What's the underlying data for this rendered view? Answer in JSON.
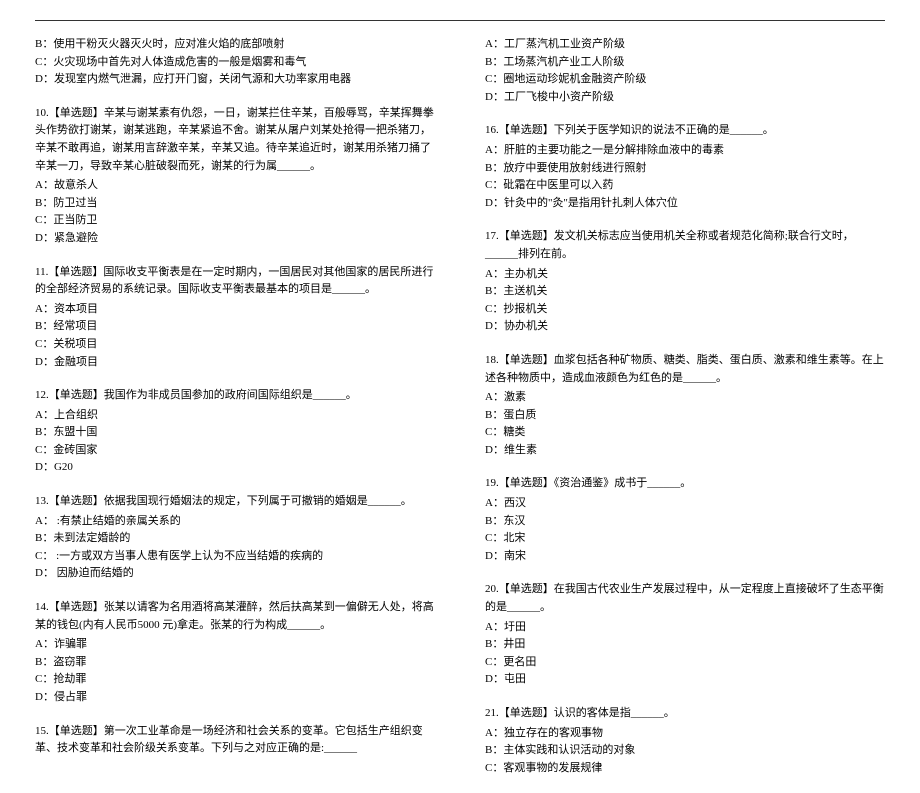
{
  "left": [
    {
      "stem": [],
      "options": [
        "B：使用干粉灭火器灭火时，应对准火焰的底部喷射",
        "C：火灾现场中首先对人体造成危害的一般是烟雾和毒气",
        "D：发现室内燃气泄漏，应打开门窗，关闭气源和大功率家用电器"
      ]
    },
    {
      "stem": [
        "10.【单选题】辛某与谢某素有仇怨，一日，谢某拦住辛某，百般辱骂，辛某挥舞拳头作势欲打谢某，谢某逃跑，辛某紧追不舍。谢某从屠户刘某处抢得一把杀猪刀，辛某不敢再追，谢某用言辞激辛某，辛某又追。待辛某追近时，谢某用杀猪刀捅了辛某一刀，导致辛某心脏破裂而死，谢某的行为属______。"
      ],
      "options": [
        "A：故意杀人",
        "B：防卫过当",
        "C：正当防卫",
        "D：紧急避险"
      ]
    },
    {
      "stem": [
        "11.【单选题】国际收支平衡表是在一定时期内，一国居民对其他国家的居民所进行的全部经济贸易的系统记录。国际收支平衡表最基本的项目是______。"
      ],
      "options": [
        "A：资本项目",
        "B：经常项目",
        "C：关税项目",
        "D：金融项目"
      ]
    },
    {
      "stem": [
        "12.【单选题】我国作为非成员国参加的政府间国际组织是______。"
      ],
      "options": [
        "A：上合组织",
        "B：东盟十国",
        "C：金砖国家",
        "D：G20"
      ]
    },
    {
      "stem": [
        "13.【单选题】依据我国现行婚姻法的规定，下列属于可撤销的婚姻是______。"
      ],
      "options": [
        "A： :有禁止结婚的亲属关系的",
        "B：未到法定婚龄的",
        "C： :一方或双方当事人患有医学上认为不应当结婚的疾病的",
        "D： 因胁迫而结婚的"
      ]
    },
    {
      "stem": [
        "14.【单选题】张某以请客为名用酒将高某灌醉，然后扶高某到一偏僻无人处，将高某的钱包(内有人民币5000 元)拿走。张某的行为构成______。"
      ],
      "options": [
        "A：诈骗罪",
        "B：盗窃罪",
        "C：抢劫罪",
        "D：侵占罪"
      ]
    },
    {
      "stem": [
        "15.【单选题】第一次工业革命是一场经济和社会关系的变革。它包括生产组织变革、技术变革和社会阶级关系变革。下列与之对应正确的是:______"
      ],
      "options": []
    }
  ],
  "right": [
    {
      "stem": [],
      "options": [
        "A：工厂蒸汽机工业资产阶级",
        "B：工场蒸汽机产业工人阶级",
        "C：圈地运动珍妮机金融资产阶级",
        "D：工厂飞梭中小资产阶级"
      ]
    },
    {
      "stem": [
        "16.【单选题】下列关于医学知识的说法不正确的是______。"
      ],
      "options": [
        "A：肝脏的主要功能之一是分解排除血液中的毒素",
        "B：放疗中要使用放射线进行照射",
        "C：砒霜在中医里可以入药",
        "D：针灸中的\"灸\"是指用针扎刺人体穴位"
      ]
    },
    {
      "stem": [
        "17.【单选题】发文机关标志应当使用机关全称或者规范化简称;联合行文时，______排列在前。"
      ],
      "options": [
        "A：主办机关",
        "B：主送机关",
        "C：抄报机关",
        "D：协办机关"
      ]
    },
    {
      "stem": [
        "18.【单选题】血浆包括各种矿物质、糖类、脂类、蛋白质、激素和维生素等。在上述各种物质中，造成血液颜色为红色的是______。"
      ],
      "options": [
        "A：激素",
        "B：蛋白质",
        "C：糖类",
        "D：维生素"
      ]
    },
    {
      "stem": [
        "19.【单选题】《资治通鉴》成书于______。"
      ],
      "options": [
        "A：西汉",
        "B：东汉",
        "C：北宋",
        "D：南宋"
      ]
    },
    {
      "stem": [
        "20.【单选题】在我国古代农业生产发展过程中，从一定程度上直接破坏了生态平衡的是______。"
      ],
      "options": [
        "A：圩田",
        "B：井田",
        "C：更名田",
        "D：屯田"
      ]
    },
    {
      "stem": [
        "21.【单选题】认识的客体是指______。"
      ],
      "options": [
        "A：独立存在的客观事物",
        "B：主体实践和认识活动的对象",
        "C：客观事物的发展规律"
      ]
    }
  ]
}
